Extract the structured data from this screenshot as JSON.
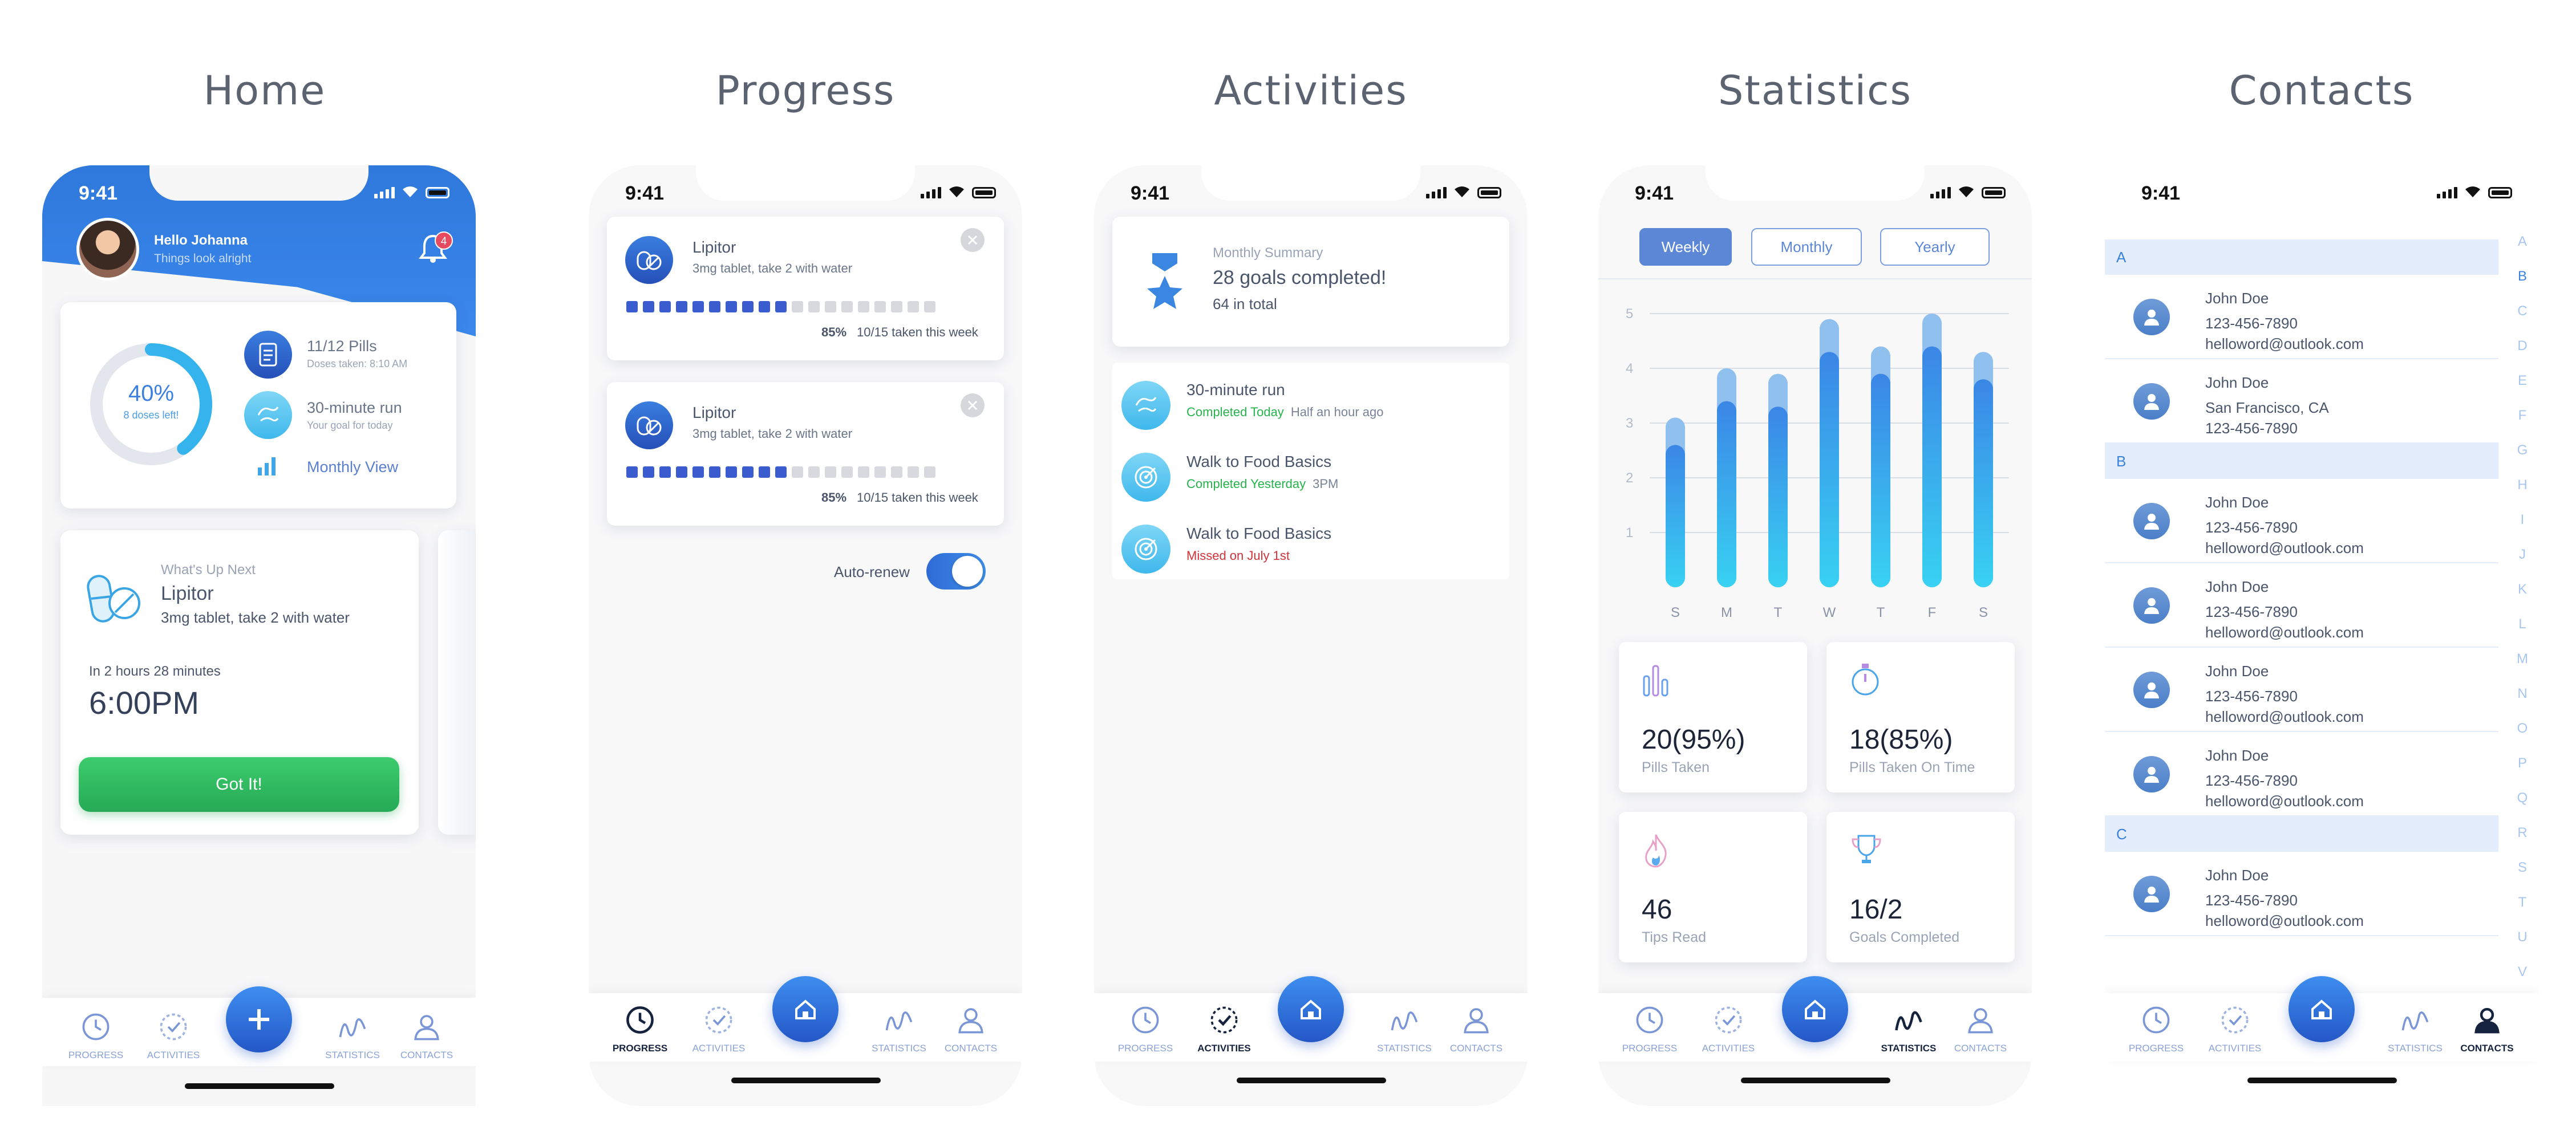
{
  "screens": {
    "home": "Home",
    "progress": "Progress",
    "activities": "Activities",
    "statistics": "Statistics",
    "contacts": "Contacts"
  },
  "status_time": "9:41",
  "tabs": {
    "progress": "PROGRESS",
    "activities": "ACTIVITIES",
    "statistics": "STATISTICS",
    "contacts": "CONTACTS"
  },
  "home": {
    "greeting": "Hello Johanna",
    "subgreeting": "Things look alright",
    "notification_count": "4",
    "ring_percent": "40%",
    "ring_caption": "8 doses left!",
    "ring_fraction": 0.4,
    "pills": "11/12 Pills",
    "pills_sub": "Doses taken: 8:10 AM",
    "run": "30-minute run",
    "run_sub": "Your goal for today",
    "monthly_view": "Monthly View",
    "next_title": "What's Up Next",
    "next_med": "Lipitor",
    "next_desc": "3mg tablet, take 2 with water",
    "countdown": "In 2 hours 28 minutes",
    "next_time": "6:00PM",
    "got_it": "Got It!"
  },
  "progress": {
    "items": [
      {
        "name": "Lipitor",
        "desc": "3mg tablet, take 2 with water",
        "percent": "85%",
        "taken": "10/15 taken this week",
        "filled": 10,
        "total": 19
      },
      {
        "name": "Lipitor",
        "desc": "3mg tablet, take 2 with water",
        "percent": "85%",
        "taken": "10/15 taken this week",
        "filled": 10,
        "total": 19
      }
    ],
    "auto_renew": "Auto-renew",
    "auto_renew_on": true
  },
  "activities": {
    "summary_label": "Monthly Summary",
    "summary_goals": "28 goals completed!",
    "summary_total": "64 in total",
    "items": [
      {
        "title": "30-minute run",
        "status": "Completed Today",
        "status_type": "completed",
        "when": "Half an hour ago"
      },
      {
        "title": "Walk to Food Basics",
        "status": "Completed Yesterday",
        "status_type": "completed",
        "when": "3PM"
      },
      {
        "title": "Walk to Food Basics",
        "status": "Missed on July 1st",
        "status_type": "missed",
        "when": ""
      }
    ]
  },
  "statistics": {
    "segments": [
      "Weekly",
      "Monthly",
      "Yearly"
    ],
    "active_segment": "Weekly",
    "chart_data": {
      "type": "bar",
      "categories": [
        "S",
        "M",
        "T",
        "W",
        "T",
        "F",
        "S"
      ],
      "series": [
        {
          "values": [
            3.1,
            4.0,
            3.9,
            4.9,
            4.4,
            5.0,
            4.3
          ]
        },
        {
          "values": [
            2.6,
            3.4,
            3.3,
            4.3,
            3.9,
            4.4,
            3.8
          ]
        }
      ],
      "ylim": [
        0,
        5
      ],
      "yticks": [
        1,
        2,
        3,
        4,
        5
      ],
      "grid": true
    },
    "cards": [
      {
        "value": "20(95%)",
        "label": "Pills Taken",
        "icon": "bars-icon"
      },
      {
        "value": "18(85%)",
        "label": "Pills Taken On Time",
        "icon": "stopwatch-icon"
      },
      {
        "value": "46",
        "label": "Tips Read",
        "icon": "flame-icon"
      },
      {
        "value": "16/2",
        "label": "Goals Completed",
        "icon": "trophy-icon"
      }
    ]
  },
  "contacts": {
    "sections": [
      {
        "letter": "A",
        "people": [
          {
            "name": "John Doe",
            "line1": "123-456-7890",
            "line2": "helloword@outlook.com"
          },
          {
            "name": "John Doe",
            "line1": "San Francisco, CA",
            "line2": "123-456-7890"
          }
        ]
      },
      {
        "letter": "B",
        "people": [
          {
            "name": "John Doe",
            "line1": "123-456-7890",
            "line2": "helloword@outlook.com"
          },
          {
            "name": "John Doe",
            "line1": "123-456-7890",
            "line2": "helloword@outlook.com"
          },
          {
            "name": "John Doe",
            "line1": "123-456-7890",
            "line2": "helloword@outlook.com"
          },
          {
            "name": "John Doe",
            "line1": "123-456-7890",
            "line2": "helloword@outlook.com"
          }
        ]
      },
      {
        "letter": "C",
        "people": [
          {
            "name": "John Doe",
            "line1": "123-456-7890",
            "line2": "helloword@outlook.com"
          }
        ]
      }
    ],
    "index": [
      "A",
      "B",
      "C",
      "D",
      "E",
      "F",
      "G",
      "H",
      "I",
      "J",
      "K",
      "L",
      "M",
      "N",
      "O",
      "P",
      "Q",
      "R",
      "S",
      "T",
      "U",
      "V"
    ],
    "active_index": "B"
  },
  "colors": {
    "primary": "#2f7bdc",
    "green": "#2dbd62",
    "progress_fill": "#3b5ccf",
    "progress_empty": "#d7d9de",
    "bar_light": "#8fc0ee",
    "missed": "#d1323a",
    "completed": "#27b34c"
  }
}
